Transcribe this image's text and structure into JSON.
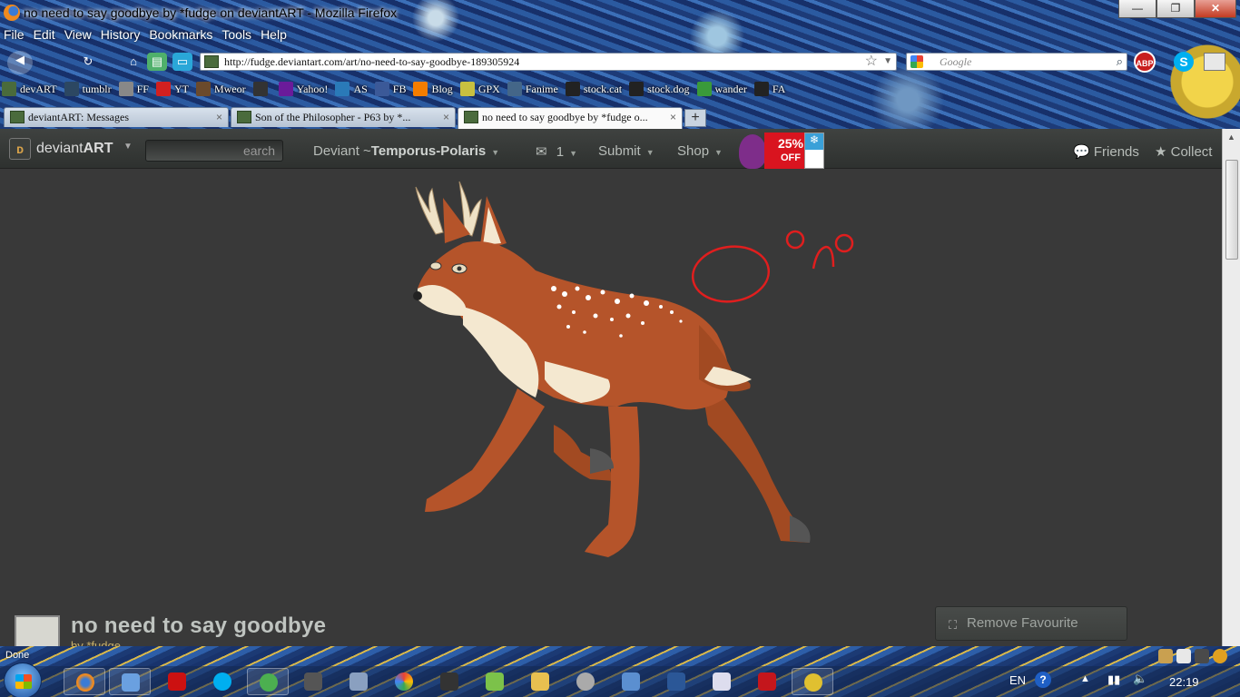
{
  "window": {
    "title": "no need to say goodbye by *fudge on deviantART - Mozilla Firefox",
    "minimize": "—",
    "maximize": "❐",
    "close": "✕"
  },
  "menu": [
    "File",
    "Edit",
    "View",
    "History",
    "Bookmarks",
    "Tools",
    "Help"
  ],
  "nav": {
    "url": "http://fudge.deviantart.com/art/no-need-to-say-goodbye-189305924",
    "search_placeholder": "Google",
    "abp_label": "ABP"
  },
  "bookmarks": [
    {
      "label": "devART",
      "color": "#4a6b3c"
    },
    {
      "label": "tumblr",
      "color": "#2c4762"
    },
    {
      "label": "FF",
      "color": "#888888"
    },
    {
      "label": "YT",
      "color": "#d12020"
    },
    {
      "label": "Mweor",
      "color": "#6b4a2c"
    },
    {
      "label": "",
      "color": "#333333"
    },
    {
      "label": "Yahoo!",
      "color": "#6a1b9a"
    },
    {
      "label": "AS",
      "color": "#2a7ab8"
    },
    {
      "label": "FB",
      "color": "#3b5998"
    },
    {
      "label": "Blog",
      "color": "#f57d00"
    },
    {
      "label": "GPX",
      "color": "#c8c040"
    },
    {
      "label": "Fanime",
      "color": "#446688"
    },
    {
      "label": "stock.cat",
      "color": "#222222"
    },
    {
      "label": "stock.dog",
      "color": "#222222"
    },
    {
      "label": "wander",
      "color": "#3a9a3a"
    },
    {
      "label": "FA",
      "color": "#222222"
    }
  ],
  "tabs": [
    {
      "label": "deviantART: Messages",
      "active": false
    },
    {
      "label": "Son of the Philosopher - P63 by *...",
      "active": false
    },
    {
      "label": "no need to say goodbye by *fudge o...",
      "active": true
    }
  ],
  "site": {
    "logo_a": "deviant",
    "logo_b": "ART",
    "search_text": "earch",
    "user_prefix": "Deviant ~",
    "username": "Temporus-Polaris",
    "messages_count": "1",
    "submit": "Submit",
    "shop": "Shop",
    "promo_percent": "25%",
    "promo_off": "OFF",
    "friends": "Friends",
    "collect": "Collect"
  },
  "deviation": {
    "title": "no need to say goodbye",
    "author": "by *fudge",
    "remove_fav": "Remove Favourite"
  },
  "status": "Done",
  "taskbar": {
    "language": "EN",
    "help": "?",
    "time": "22:19"
  },
  "colors": {
    "fur": "#b5542a",
    "cream": "#f4e8d0",
    "annotation": "#e01e1e"
  }
}
